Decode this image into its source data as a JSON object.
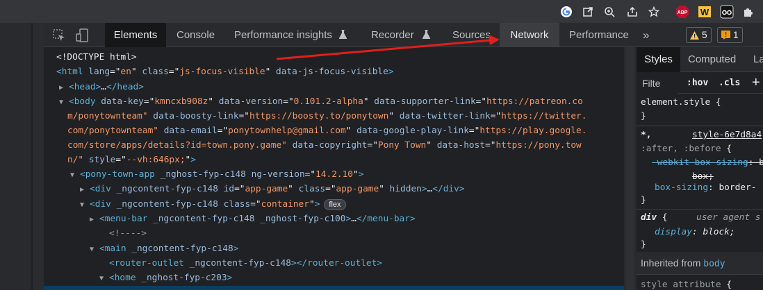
{
  "browser_bar": {
    "extensions": [
      {
        "icon": "google-icon",
        "label": "G"
      },
      {
        "icon": "open-in-new-icon",
        "label": "⧉"
      },
      {
        "icon": "zoom-icon",
        "label": "⊕"
      },
      {
        "icon": "share-icon",
        "label": "⇪"
      },
      {
        "icon": "star-icon",
        "label": "☆"
      },
      {
        "icon": "adblock-plus-icon",
        "label": "ABP"
      },
      {
        "icon": "w-extension-icon",
        "label": "W"
      },
      {
        "icon": "glasses-extension-icon",
        "label": "oo"
      },
      {
        "icon": "puzzle-extensions-icon",
        "label": "✱"
      }
    ]
  },
  "devtools": {
    "tabs": [
      "Elements",
      "Console",
      "Performance insights",
      "Recorder",
      "Sources",
      "Network",
      "Performance"
    ],
    "more_tabs": "»",
    "warnings_count": "5",
    "issues_count": "1"
  },
  "dom": {
    "doctype": "<!DOCTYPE html>",
    "html_open": {
      "tag": "html",
      "attrs": [
        [
          "lang",
          "en"
        ],
        [
          "class",
          "js-focus-visible"
        ]
      ],
      "bare_attr": "data-js-focus-visible"
    },
    "head": {
      "text": "head",
      "ellipsis": "…"
    },
    "body_lines": [
      {
        "pre": "",
        "name": "data-key",
        "value": "kmncxb908z",
        "name2": "data-version",
        "value2": "0.101.2-alpha",
        "name3": "data-supporter-link",
        "value3": "https://patreon.co"
      },
      {
        "cont": "m/ponytownteam\"",
        "name": "data-boosty-link",
        "value": "https://boosty.to/ponytown",
        "name2": "data-twitter-link",
        "value2": "https://twitter."
      },
      {
        "cont": "com/ponytownteam\"",
        "name": "data-email",
        "value": "ponytownhelp@gmail.com",
        "name2": "data-google-play-link",
        "value2": "https://play.google."
      },
      {
        "cont": "com/store/apps/details?id=town.pony.game\"",
        "name": "data-copyright",
        "value": "Pony Town",
        "name2": "data-host",
        "value2": "https://pony.tow"
      },
      {
        "cont": "n/\"",
        "name": "style",
        "value": "--vh:646px;"
      }
    ],
    "pony_town_app": {
      "tag": "pony-town-app",
      "a1": "_nghost-fyp-c148",
      "a2name": "ng-version",
      "a2value": "14.2.10"
    },
    "app_game_div": {
      "tag": "div",
      "a1": "_ngcontent-fyp-c148",
      "idv": "app-game",
      "classv": "app-game",
      "bare": "hidden"
    },
    "container_div": {
      "tag": "div",
      "a1": "_ngcontent-fyp-c148",
      "classv": "container",
      "badge": "flex"
    },
    "menu_bar": {
      "tag": "menu-bar",
      "a1": "_ngcontent-fyp-c148",
      "a2": "_nghost-fyp-c100"
    },
    "comment": "<!---->",
    "main": {
      "tag": "main",
      "a1": "_ngcontent-fyp-c148"
    },
    "router_outlet": {
      "tag": "router-outlet",
      "a1": "_ngcontent-fyp-c148"
    },
    "home": {
      "tag": "home",
      "a1": "_nghost-fyp-c203"
    }
  },
  "styles_pane": {
    "tabs": [
      "Styles",
      "Computed",
      "La"
    ],
    "filter_placeholder": "Filte",
    "hov": ":hov",
    "cls": ".cls",
    "plus": "+",
    "element_style": "element.style",
    "rule1_selector": "*,",
    "rule1_source": "style-6e7d8a4",
    "rule1_pseudo": ":after, :before",
    "webkit_prop": "-webkit-box-sizing",
    "webkit_val": "box;",
    "box_sizing_prop": "box-sizing",
    "box_sizing_val": "border-",
    "rule2_selector": "div",
    "rule2_source": "user agent s",
    "display_prop": "display",
    "display_val": "block;",
    "inherited_label": "Inherited from",
    "inherited_tag": "body",
    "style_attr": "style attribute"
  }
}
